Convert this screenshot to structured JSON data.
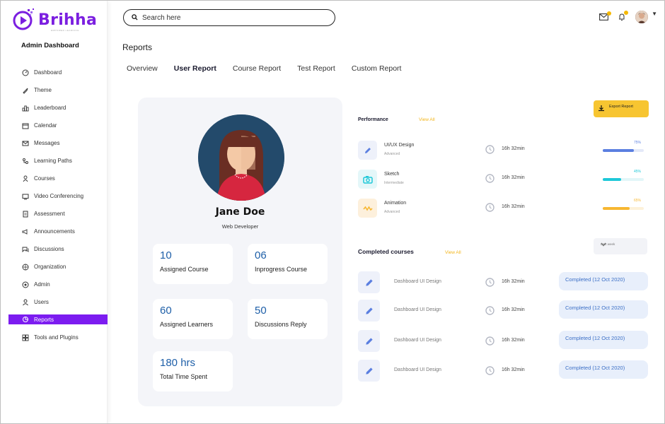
{
  "app": {
    "brand": "Brihha",
    "brand_tagline": "EMPOWER LEARNING",
    "dashboard_title": "Admin Dashboard",
    "accent_color": "#7c1cf0"
  },
  "sidebar": {
    "items": [
      {
        "label": "Dashboard",
        "icon": "dashboard-icon"
      },
      {
        "label": "Theme",
        "icon": "theme-icon"
      },
      {
        "label": "Leaderboard",
        "icon": "leaderboard-icon"
      },
      {
        "label": "Calendar",
        "icon": "calendar-icon"
      },
      {
        "label": "Messages",
        "icon": "messages-icon"
      },
      {
        "label": "Learning Paths",
        "icon": "learning-paths-icon"
      },
      {
        "label": "Courses",
        "icon": "courses-icon"
      },
      {
        "label": "Video Conferencing",
        "icon": "video-icon"
      },
      {
        "label": "Assessment",
        "icon": "assessment-icon"
      },
      {
        "label": "Announcements",
        "icon": "announcements-icon"
      },
      {
        "label": "Discussions",
        "icon": "discussions-icon"
      },
      {
        "label": "Organization",
        "icon": "organization-icon"
      },
      {
        "label": "Admin",
        "icon": "admin-icon"
      },
      {
        "label": "Users",
        "icon": "users-icon"
      },
      {
        "label": "Reports",
        "icon": "reports-icon",
        "active": true
      },
      {
        "label": "Tools and Plugins",
        "icon": "tools-icon"
      }
    ]
  },
  "header": {
    "search_placeholder": "Search here"
  },
  "main": {
    "title": "Reports",
    "tabs": [
      {
        "label": "Overview"
      },
      {
        "label": "User Report",
        "active": true
      },
      {
        "label": "Course Report"
      },
      {
        "label": "Test Report"
      },
      {
        "label": "Custom Report"
      }
    ]
  },
  "profile": {
    "name": "Jane Doe",
    "role": "Web Developer",
    "stats": [
      {
        "value": "10",
        "label": "Assigned Course"
      },
      {
        "value": "06",
        "label": "Inprogress Course"
      },
      {
        "value": "60",
        "label": "Assigned Learners"
      },
      {
        "value": "50",
        "label": "Discussions Reply"
      },
      {
        "value": "180 hrs",
        "label": "Total Time Spent"
      }
    ]
  },
  "performance": {
    "title": "Performance",
    "view_all": "View All",
    "export_label": "Export Report",
    "items": [
      {
        "name": "UI/UX Design",
        "level": "Advanced",
        "time": "16h 32min",
        "percent_label": "75%",
        "progress": 0.75,
        "color": "#5b7fe0",
        "track": "#e4e9f8",
        "icon": "pencil-icon",
        "icon_bg": "#eef1fa"
      },
      {
        "name": "Sketch",
        "level": "Intermediate",
        "time": "16h 32min",
        "percent_label": "45%",
        "progress": 0.45,
        "color": "#1ec8d8",
        "track": "#e2f6f8",
        "icon": "camera-icon",
        "icon_bg": "#e4f7f9"
      },
      {
        "name": "Animation",
        "level": "Advanced",
        "time": "16h 32min",
        "percent_label": "65%",
        "progress": 0.65,
        "color": "#f7b731",
        "track": "#fdf1d9",
        "icon": "wave-icon",
        "icon_bg": "#fdf0dc"
      }
    ]
  },
  "completed": {
    "title": "Completed courses",
    "view_all": "View All",
    "filter": "Last week",
    "rows": [
      {
        "name": "Dashboard UI Design",
        "time": "16h 32min",
        "status": "Completed (12 Oct 2020)"
      },
      {
        "name": "Dashboard UI Design",
        "time": "16h 32min",
        "status": "Completed (12 Oct 2020)"
      },
      {
        "name": "Dashboard UI Design",
        "time": "16h 32min",
        "status": "Completed (12 Oct 2020)"
      },
      {
        "name": "Dashboard UI Design",
        "time": "16h 32min",
        "status": "Completed (12 Oct 2020)"
      }
    ]
  }
}
